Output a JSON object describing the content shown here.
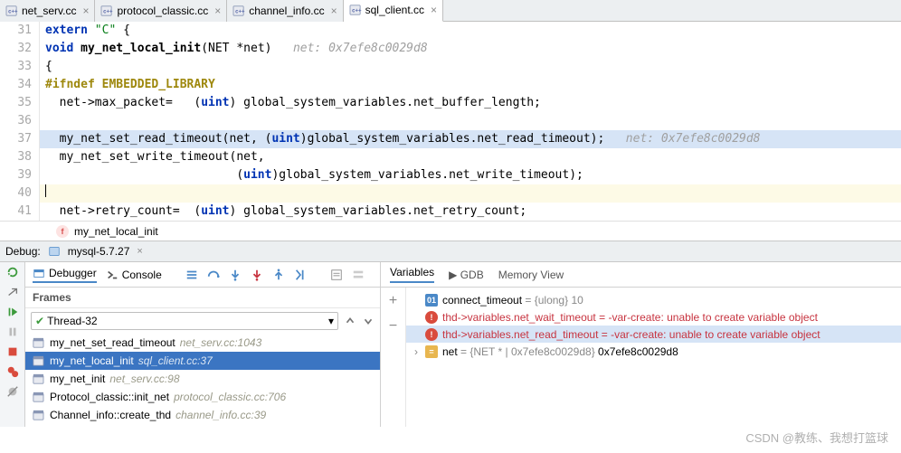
{
  "tabs": [
    {
      "label": "net_serv.cc",
      "active": false
    },
    {
      "label": "protocol_classic.cc",
      "active": false
    },
    {
      "label": "channel_info.cc",
      "active": false
    },
    {
      "label": "sql_client.cc",
      "active": true
    }
  ],
  "editor": {
    "lines": [
      {
        "n": "31",
        "seg": [
          {
            "t": "extern ",
            "c": "kw"
          },
          {
            "t": "\"C\"",
            "c": "str"
          },
          {
            "t": " {",
            "c": ""
          }
        ]
      },
      {
        "n": "32",
        "seg": [
          {
            "t": "void ",
            "c": "kw"
          },
          {
            "t": "my_net_local_init",
            "c": "func"
          },
          {
            "t": "(NET *net)   ",
            "c": ""
          },
          {
            "t": "net: 0x7efe8c0029d8",
            "c": "inlay"
          }
        ]
      },
      {
        "n": "33",
        "seg": [
          {
            "t": "{",
            "c": ""
          }
        ]
      },
      {
        "n": "34",
        "seg": [
          {
            "t": "#ifndef EMBEDDED_LIBRARY",
            "c": "pp"
          }
        ]
      },
      {
        "n": "35",
        "seg": [
          {
            "t": "  net->max_packet=   (",
            "c": ""
          },
          {
            "t": "uint",
            "c": "type"
          },
          {
            "t": ") global_system_variables.net_buffer_length;",
            "c": ""
          }
        ]
      },
      {
        "n": "36",
        "seg": []
      },
      {
        "n": "37",
        "hl": true,
        "seg": [
          {
            "t": "  my_net_set_read_timeout(net, (",
            "c": ""
          },
          {
            "t": "uint",
            "c": "type"
          },
          {
            "t": ")global_system_variables.net_read_timeout);   ",
            "c": ""
          },
          {
            "t": "net: 0x7efe8c0029d8",
            "c": "inlay"
          }
        ]
      },
      {
        "n": "38",
        "seg": [
          {
            "t": "  my_net_set_write_timeout(net,",
            "c": ""
          }
        ]
      },
      {
        "n": "39",
        "seg": [
          {
            "t": "                           (",
            "c": ""
          },
          {
            "t": "uint",
            "c": "type"
          },
          {
            "t": ")global_system_variables.net_write_timeout);",
            "c": ""
          }
        ]
      },
      {
        "n": "40",
        "cursor": true,
        "seg": []
      },
      {
        "n": "41",
        "seg": [
          {
            "t": "  net->retry_count=  (",
            "c": ""
          },
          {
            "t": "uint",
            "c": "type"
          },
          {
            "t": ") global_system_variables.net_retry_count;",
            "c": ""
          }
        ]
      }
    ]
  },
  "breadcrumb": {
    "icon": "f",
    "label": "my_net_local_init"
  },
  "debug": {
    "title": "Debug:",
    "run_config": "mysql-5.7.27",
    "tabs": {
      "debugger": "Debugger",
      "console": "Console"
    },
    "frames_label": "Frames",
    "thread": "Thread-32",
    "frames": [
      {
        "name": "my_net_set_read_timeout",
        "loc": "net_serv.cc:1043",
        "sel": false
      },
      {
        "name": "my_net_local_init",
        "loc": "sql_client.cc:37",
        "sel": true
      },
      {
        "name": "my_net_init",
        "loc": "net_serv.cc:98",
        "sel": false
      },
      {
        "name": "Protocol_classic::init_net",
        "loc": "protocol_classic.cc:706",
        "sel": false
      },
      {
        "name": "Channel_info::create_thd",
        "loc": "channel_info.cc:39",
        "sel": false
      }
    ],
    "vars_tabs": {
      "variables": "Variables",
      "gdb": "GDB",
      "memory": "Memory View"
    },
    "vars": [
      {
        "icon": "01",
        "name": "connect_timeout",
        "val": " = {ulong} 10"
      },
      {
        "icon": "err",
        "name": "thd->variables.net_wait_timeout",
        "err": " = -var-create: unable to create variable object"
      },
      {
        "icon": "err",
        "name": "thd->variables.net_read_timeout",
        "err": " = -var-create: unable to create variable object",
        "sel": true
      },
      {
        "icon": "eq",
        "exp": true,
        "name": "net",
        "dim": " = {NET * | 0x7efe8c0029d8} ",
        "val": "0x7efe8c0029d8"
      }
    ]
  },
  "watermark": "CSDN @教练、我想打篮球"
}
